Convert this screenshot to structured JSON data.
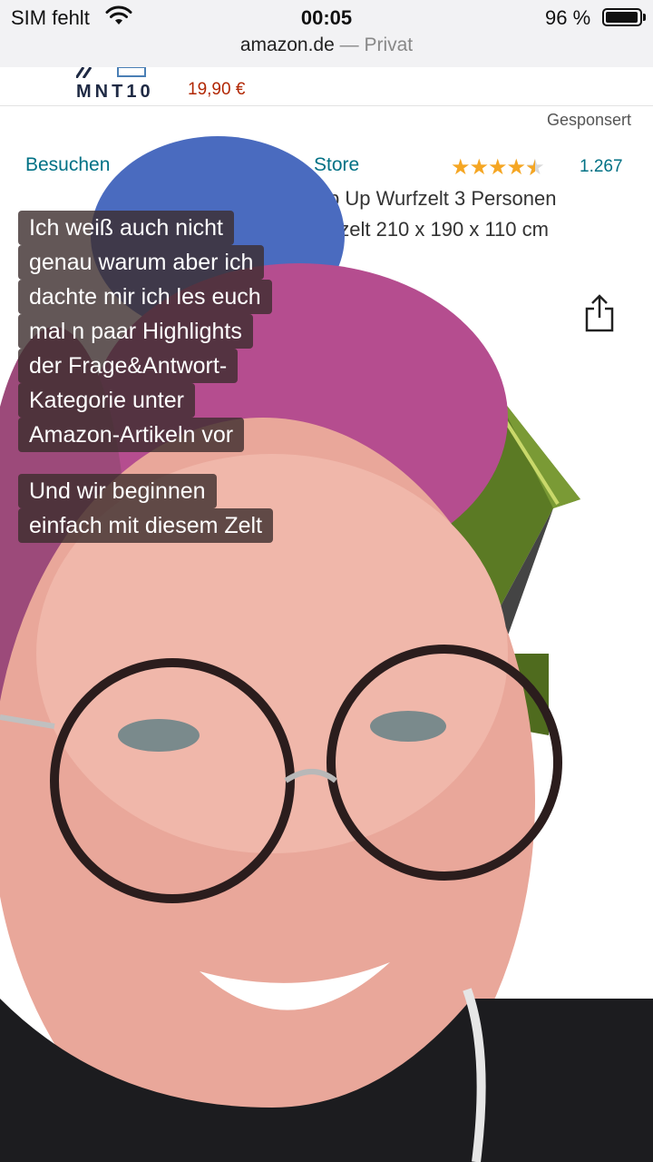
{
  "status_bar": {
    "carrier": "SIM fehlt",
    "time": "00:05",
    "battery": "96 %",
    "battery_level": 0.96
  },
  "browser": {
    "domain": "amazon.de",
    "separator": " — ",
    "mode": "Privat"
  },
  "top_ad": {
    "brand": "MNT10",
    "price": "19,90 €"
  },
  "product": {
    "sponsored": "Gesponsert",
    "store_link": "Besuchen Sie den ... Store",
    "store_visible_left": "Besuchen",
    "store_visible_right": "Store",
    "rating_stars": 4.5,
    "rating_count": "1.267",
    "title_line1": "p Up Wurfzelt 3 Personen",
    "title_line2": "nzelt 210 x 190 x 110 cm"
  },
  "captions": {
    "block1": [
      "Ich weiß auch nicht",
      "genau warum aber ich",
      "dachte mir ich les euch",
      "mal n paar Highlights",
      "der Frage&Antwort-",
      "Kategorie unter",
      "Amazon-Artikeln vor"
    ],
    "block2": [
      "Und wir beginnen",
      "einfach mit diesem Zelt"
    ]
  },
  "icons": {
    "wifi": "wifi-icon",
    "battery": "battery-icon",
    "share": "share-icon",
    "tent": "tent-image",
    "person": "person-video-overlay"
  }
}
